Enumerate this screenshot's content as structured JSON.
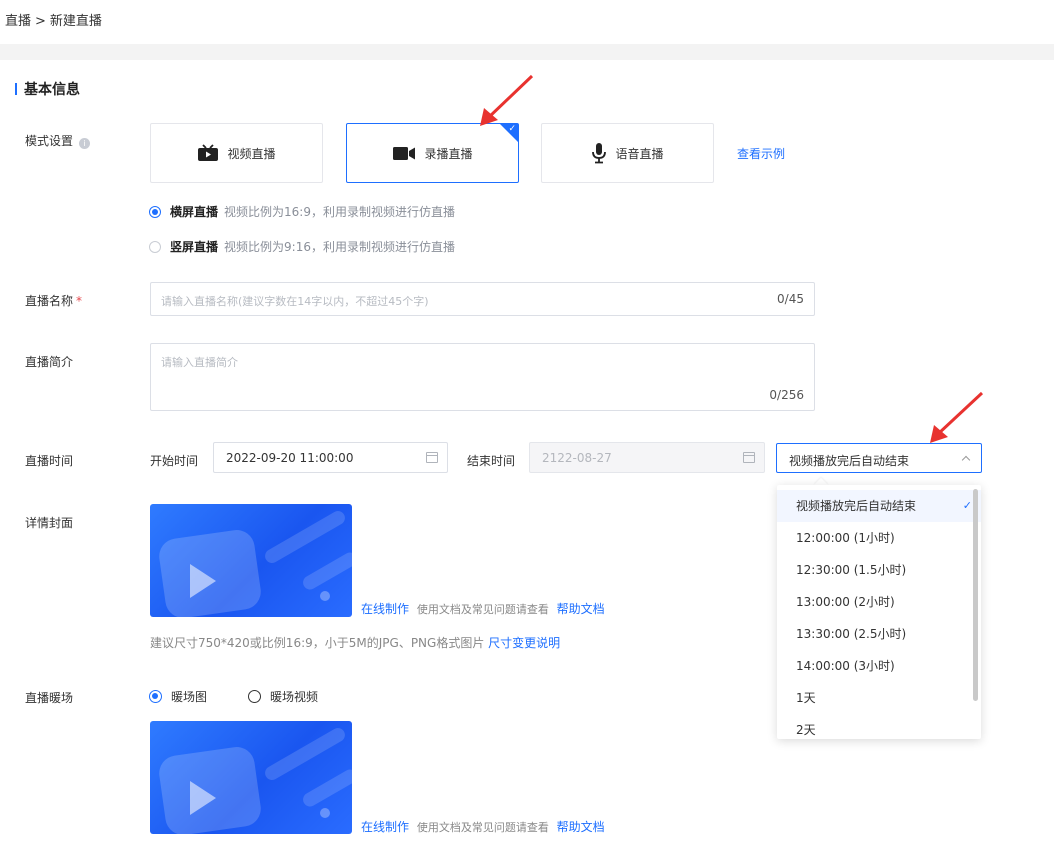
{
  "breadcrumb": {
    "parent": "直播",
    "separator": ">",
    "current": "新建直播"
  },
  "section": {
    "title": "基本信息"
  },
  "mode": {
    "label": "模式设置",
    "info_icon": "i",
    "cards": [
      {
        "label": "视频直播",
        "icon": "tv-icon"
      },
      {
        "label": "录播直播",
        "icon": "video-camera-icon",
        "selected": true
      },
      {
        "label": "语音直播",
        "icon": "microphone-icon"
      }
    ],
    "example_link": "查看示例",
    "orientations": [
      {
        "label": "横屏直播",
        "hint": "视频比例为16:9，利用录制视频进行仿直播",
        "checked": true
      },
      {
        "label": "竖屏直播",
        "hint": "视频比例为9:16，利用录制视频进行仿直播",
        "checked": false
      }
    ]
  },
  "name": {
    "label": "直播名称",
    "required_mark": "*",
    "placeholder": "请输入直播名称(建议字数在14字以内，不超过45个字)",
    "counter": "0/45"
  },
  "intro": {
    "label": "直播简介",
    "placeholder": "请输入直播简介",
    "counter": "0/256"
  },
  "time": {
    "label": "直播时间",
    "start_label": "开始时间",
    "start_value": "2022-09-20 11:00:00",
    "end_label": "结束时间",
    "end_value": "2122-08-27",
    "end_mode": "视频播放完后自动结束",
    "options": [
      "视频播放完后自动结束",
      "12:00:00 (1小时)",
      "12:30:00 (1.5小时)",
      "13:00:00 (2小时)",
      "13:30:00 (2.5小时)",
      "14:00:00 (3小时)",
      "1天",
      "2天"
    ],
    "selected_check": "✓"
  },
  "cover": {
    "label": "详情封面",
    "make_online": "在线制作",
    "doc_hint": "使用文档及常见问题请查看",
    "help_doc": "帮助文档",
    "size_hint": "建议尺寸750*420或比例16:9，小于5M的JPG、PNG格式图片",
    "size_link": "尺寸变更说明"
  },
  "warmup": {
    "label": "直播暖场",
    "options": [
      {
        "label": "暖场图",
        "checked": true
      },
      {
        "label": "暖场视频",
        "checked": false
      }
    ],
    "make_online": "在线制作",
    "doc_hint": "使用文档及常见问题请查看",
    "help_doc": "帮助文档"
  },
  "colors": {
    "accent": "#1e6fff",
    "required": "#e5484d",
    "arrow": "#e8322f"
  }
}
